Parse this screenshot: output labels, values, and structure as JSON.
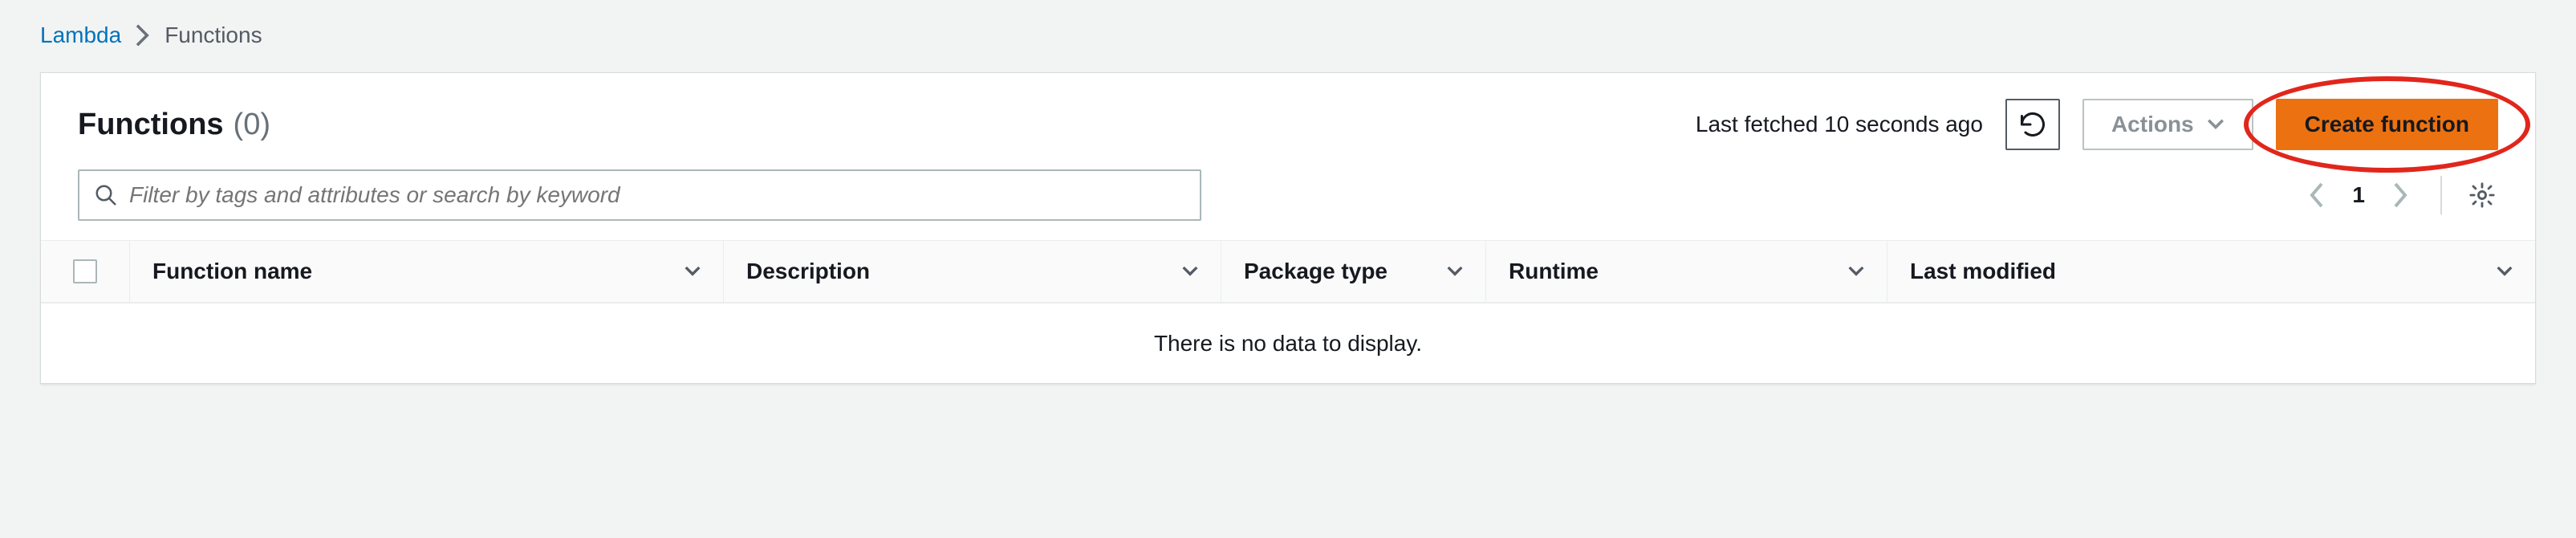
{
  "breadcrumb": {
    "root": "Lambda",
    "current": "Functions"
  },
  "header": {
    "title": "Functions",
    "count": "(0)",
    "last_fetched": "Last fetched 10 seconds ago",
    "actions_label": "Actions",
    "create_label": "Create function"
  },
  "filter": {
    "placeholder": "Filter by tags and attributes or search by keyword"
  },
  "pager": {
    "current_page": "1"
  },
  "columns": {
    "c1": "Function name",
    "c2": "Description",
    "c3": "Package type",
    "c4": "Runtime",
    "c5": "Last modified"
  },
  "empty_message": "There is no data to display."
}
